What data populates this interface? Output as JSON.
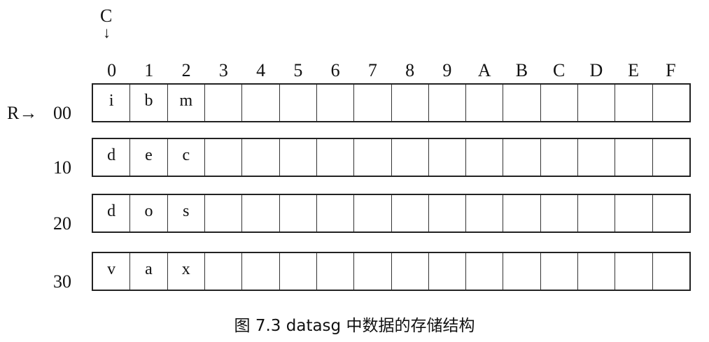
{
  "diagram": {
    "column_marker": "C",
    "column_arrow": "↓",
    "row_marker": "R→",
    "columns": [
      "0",
      "1",
      "2",
      "3",
      "4",
      "5",
      "6",
      "7",
      "8",
      "9",
      "A",
      "B",
      "C",
      "D",
      "E",
      "F"
    ],
    "rows": [
      {
        "label": "00",
        "cells": [
          "i",
          "b",
          "m",
          "",
          "",
          "",
          "",
          "",
          "",
          "",
          "",
          "",
          "",
          "",
          "",
          ""
        ]
      },
      {
        "label": "10",
        "cells": [
          "d",
          "e",
          "c",
          "",
          "",
          "",
          "",
          "",
          "",
          "",
          "",
          "",
          "",
          "",
          "",
          ""
        ]
      },
      {
        "label": "20",
        "cells": [
          "d",
          "o",
          "s",
          "",
          "",
          "",
          "",
          "",
          "",
          "",
          "",
          "",
          "",
          "",
          "",
          ""
        ]
      },
      {
        "label": "30",
        "cells": [
          "v",
          "a",
          "x",
          "",
          "",
          "",
          "",
          "",
          "",
          "",
          "",
          "",
          "",
          "",
          "",
          ""
        ]
      }
    ],
    "caption": "图 7.3    datasg 中数据的存储结构"
  }
}
